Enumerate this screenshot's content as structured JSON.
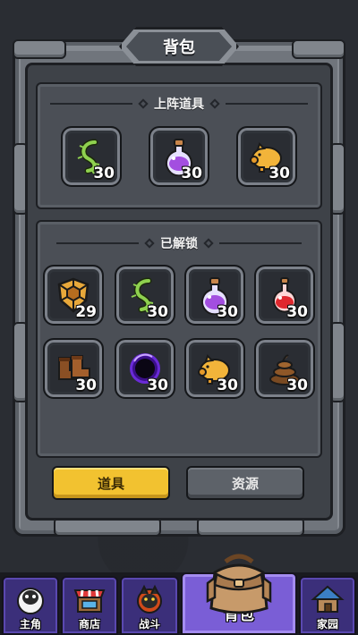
{
  "title": "背包",
  "sections": {
    "equipped": {
      "header": "上阵道具",
      "items": [
        {
          "icon": "thorn-vine-icon",
          "count": "30"
        },
        {
          "icon": "purple-potion-icon",
          "count": "30"
        },
        {
          "icon": "piggy-bank-icon",
          "count": "30"
        }
      ]
    },
    "unlocked": {
      "header": "已解锁",
      "items": [
        {
          "icon": "turtle-shield-icon",
          "count": "29"
        },
        {
          "icon": "thorn-vine-icon",
          "count": "30"
        },
        {
          "icon": "purple-potion-icon",
          "count": "30"
        },
        {
          "icon": "red-potion-icon",
          "count": "30"
        },
        {
          "icon": "leather-boots-icon",
          "count": "30"
        },
        {
          "icon": "black-hole-icon",
          "count": "30"
        },
        {
          "icon": "piggy-bank-icon",
          "count": "30"
        },
        {
          "icon": "poop-icon",
          "count": "30"
        }
      ]
    }
  },
  "tabs": {
    "items": "道具",
    "resources": "资源",
    "active": "items"
  },
  "nav": [
    {
      "label": "主角",
      "icon": "sheep-icon"
    },
    {
      "label": "商店",
      "icon": "shop-stall-icon"
    },
    {
      "label": "战斗",
      "icon": "battle-wolf-icon"
    },
    {
      "label": "背包",
      "icon": "backpack-icon",
      "active": true
    },
    {
      "label": "家园",
      "icon": "house-icon"
    }
  ],
  "colors": {
    "accent_yellow": "#f2c230",
    "nav_active": "#7a5ed6",
    "nav_inactive": "#3b2f7a",
    "frame_stone": "#70757c"
  }
}
